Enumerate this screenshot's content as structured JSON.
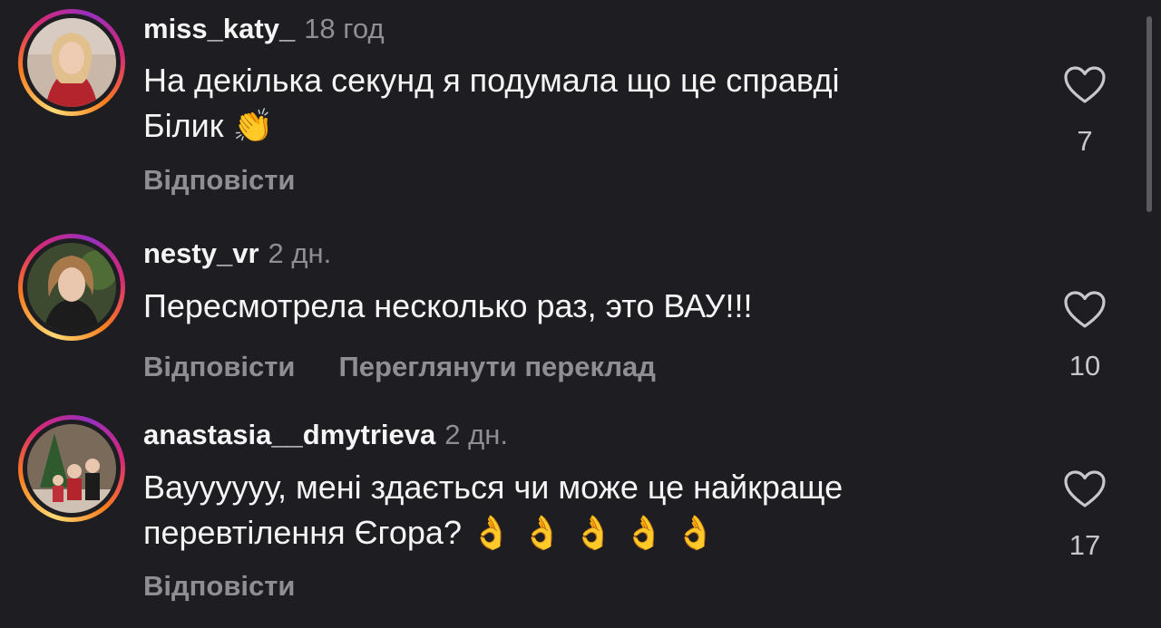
{
  "comments": [
    {
      "username": "miss_katy_",
      "time": "18 год",
      "text_line1": "На декілька секунд я подумала що це справді",
      "text_line2": "Білик",
      "emoji": "👏",
      "reply_label": "Відповісти",
      "likes": "7"
    },
    {
      "username": "nesty_vr",
      "time": "2 дн.",
      "text_line1": "Пересмотрела несколько раз, это ВАУ!!!",
      "reply_label": "Відповісти",
      "translate_label": "Переглянути переклад",
      "likes": "10"
    },
    {
      "username": "anastasia__dmytrieva",
      "time": "2 дн.",
      "text_line1": "Вауууууу, мені здається чи може це найкраще",
      "text_line2": "перевтілення Єгора?",
      "emoji": "👌 👌 👌 👌 👌",
      "reply_label": "Відповісти",
      "likes": "17"
    }
  ],
  "icons": {
    "like": "heart-outline-icon"
  },
  "colors": {
    "background": "#1e1e22",
    "text": "#f5f5f5",
    "secondary": "#8e8e93"
  }
}
